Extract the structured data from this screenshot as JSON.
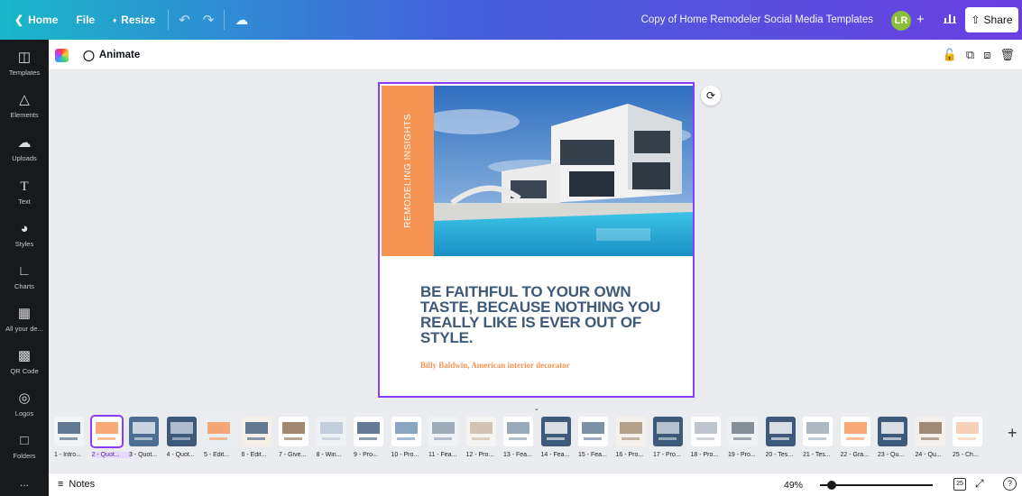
{
  "topbar": {
    "home_label": "Home",
    "file_label": "File",
    "resize_label": "Resize",
    "doc_title": "Copy of Home Remodeler Social Media Templates",
    "avatar_initials": "LR",
    "share_label": "Share"
  },
  "sidebar": {
    "items": [
      {
        "label": "Templates",
        "icon": "templates-icon"
      },
      {
        "label": "Elements",
        "icon": "elements-icon"
      },
      {
        "label": "Uploads",
        "icon": "uploads-icon"
      },
      {
        "label": "Text",
        "icon": "text-icon"
      },
      {
        "label": "Styles",
        "icon": "styles-icon"
      },
      {
        "label": "Charts",
        "icon": "charts-icon"
      },
      {
        "label": "All your de...",
        "icon": "all-designs-icon"
      },
      {
        "label": "QR Code",
        "icon": "qr-code-icon"
      },
      {
        "label": "Logos",
        "icon": "logos-icon"
      },
      {
        "label": "Folders",
        "icon": "folders-icon"
      },
      {
        "label": "...",
        "icon": "more-icon"
      }
    ]
  },
  "toolbar": {
    "animate_label": "Animate"
  },
  "canvas": {
    "vertical_text": "REMODELING INSIGHTS",
    "quote": "BE FAITHFUL TO YOUR OWN TASTE, BECAUSE NOTHING YOU REALLY LIKE IS EVER OUT OF STYLE.",
    "author": "Billy Baldwin, American interior decorator",
    "accent_color": "#f69454",
    "quote_color": "#3e5a7a"
  },
  "pages": [
    {
      "label": "1 - Intro..."
    },
    {
      "label": "2 - Quot...",
      "selected": true
    },
    {
      "label": "3 - Quot..."
    },
    {
      "label": "4 - Quot..."
    },
    {
      "label": "5 - Edit..."
    },
    {
      "label": "6 - Edit..."
    },
    {
      "label": "7 - Give..."
    },
    {
      "label": "8 - Win..."
    },
    {
      "label": "9 - Pro..."
    },
    {
      "label": "10 - Pro..."
    },
    {
      "label": "11 - Fea..."
    },
    {
      "label": "12 - Pro..."
    },
    {
      "label": "13 - Fea..."
    },
    {
      "label": "14 - Fea..."
    },
    {
      "label": "15 - Fea..."
    },
    {
      "label": "16 - Pro..."
    },
    {
      "label": "17 - Pro..."
    },
    {
      "label": "18 - Pro..."
    },
    {
      "label": "19 - Pro..."
    },
    {
      "label": "20 - Tes..."
    },
    {
      "label": "21 - Tes..."
    },
    {
      "label": "22 - Gra..."
    },
    {
      "label": "23 - Qu..."
    },
    {
      "label": "24 - Qu..."
    },
    {
      "label": "25 - Ch..."
    }
  ],
  "bottombar": {
    "notes_label": "Notes",
    "zoom": "49%",
    "zoom_fraction": 0.1,
    "page_count": "25"
  }
}
